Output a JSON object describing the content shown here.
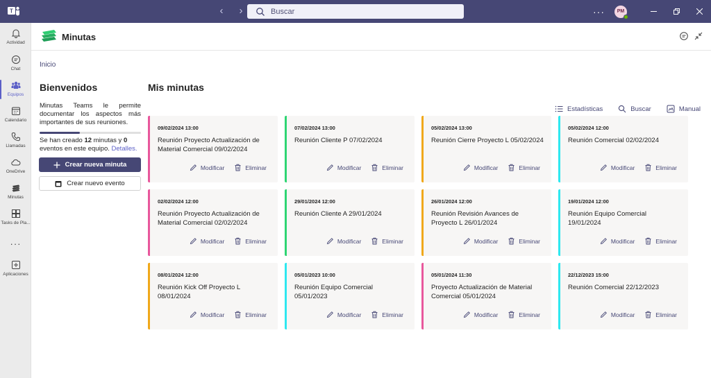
{
  "titlebar": {
    "search_placeholder": "Buscar",
    "more": "···",
    "avatar_initials": "PM"
  },
  "rail": {
    "items": [
      {
        "label": "Actividad",
        "icon": "bell-icon"
      },
      {
        "label": "Chat",
        "icon": "chat-icon"
      },
      {
        "label": "Equipos",
        "icon": "teams-icon",
        "active": true
      },
      {
        "label": "Calendario",
        "icon": "calendar-icon"
      },
      {
        "label": "Llamadas",
        "icon": "phone-icon"
      },
      {
        "label": "OneDrive",
        "icon": "cloud-icon"
      },
      {
        "label": "Minutas",
        "icon": "minutas-icon"
      },
      {
        "label": "Tasks de Pla...",
        "icon": "tasks-icon"
      },
      {
        "label": "Aplicaciones",
        "icon": "add-apps-icon"
      }
    ],
    "more": "···"
  },
  "app": {
    "title": "Minutas",
    "breadcrumb": "Inicio"
  },
  "welcome": {
    "title": "Bienvenidos",
    "text": "Minutas Teams le permite documentar los aspectos más importantes de sus reuniones.",
    "stats_prefix": "Se han creado ",
    "minutes_count": "12",
    "stats_mid": " minutas y ",
    "events_count": "0",
    "stats_suffix": " eventos en este equipo. ",
    "details_link": "Detalles.",
    "progress": 0.4,
    "create_minute": "Crear nueva minuta",
    "create_event": "Crear nuevo evento"
  },
  "main": {
    "title": "Mis minutas",
    "toolbar": {
      "stats": "Estadísticas",
      "search": "Buscar",
      "manual": "Manual"
    },
    "edit_label": "Modificar",
    "delete_label": "Eliminar",
    "cards": [
      {
        "date": "09/02/2024 13:00",
        "title": "Reunión Proyecto Actualización de Material Comercial 09/02/2024",
        "color": "#e8579c"
      },
      {
        "date": "07/02/2024 13:00",
        "title": "Reunión Cliente P 07/02/2024",
        "color": "#2ed573"
      },
      {
        "date": "05/02/2024 13:00",
        "title": "Reunión Cierre Proyecto L 05/02/2024",
        "color": "#f0a81a"
      },
      {
        "date": "05/02/2024 12:00",
        "title": "Reunión Comercial 02/02/2024",
        "color": "#2ee8f0"
      },
      {
        "date": "02/02/2024 12:00",
        "title": "Reunión Proyecto Actualización de Material Comercial 02/02/2024",
        "color": "#e8579c"
      },
      {
        "date": "29/01/2024 12:00",
        "title": "Reunión Cliente A 29/01/2024",
        "color": "#2ed573"
      },
      {
        "date": "26/01/2024 12:00",
        "title": "Reunión Revisión Avances de Proyecto L 26/01/2024",
        "color": "#f0a81a"
      },
      {
        "date": "19/01/2024 12:00",
        "title": "Reunión Equipo Comercial 19/01/2024",
        "color": "#2ee8f0"
      },
      {
        "date": "08/01/2024 12:00",
        "title": "Reunión Kick Off Proyecto L 08/01/2024",
        "color": "#f0a81a"
      },
      {
        "date": "05/01/2023 10:00",
        "title": "Reunión Equipo Comercial 05/01/2023",
        "color": "#2ee8f0"
      },
      {
        "date": "05/01/2024 11:30",
        "title": "Proyecto Actualización de Material Comercial 05/01/2024",
        "color": "#e8579c"
      },
      {
        "date": "22/12/2023 15:00",
        "title": "Reunión Comercial 22/12/2023",
        "color": "#2ee8f0"
      }
    ]
  }
}
